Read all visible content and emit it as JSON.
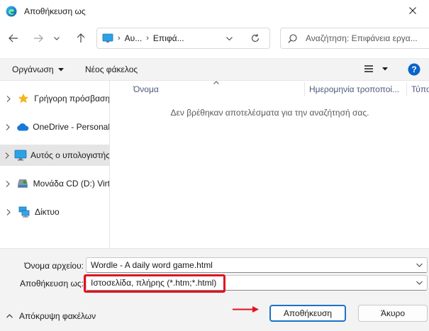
{
  "window": {
    "title": "Αποθήκευση ως"
  },
  "address": {
    "crumbs": [
      "Αυ...",
      "Επιφά..."
    ]
  },
  "search": {
    "placeholder": "Αναζήτηση: Επιφάνεια εργα..."
  },
  "toolbar": {
    "organize_label": "Οργάνωση",
    "new_folder_label": "Νέος φάκελος"
  },
  "sidebar": {
    "items": [
      {
        "label": "Γρήγορη πρόσβαση",
        "icon": "star-icon"
      },
      {
        "label": "OneDrive - Personal",
        "icon": "cloud-icon"
      },
      {
        "label": "Αυτός ο υπολογιστής",
        "icon": "computer-icon",
        "selected": true
      },
      {
        "label": "Μονάδα CD (D:) Virt",
        "icon": "cd-drive-icon"
      },
      {
        "label": "Δίκτυο",
        "icon": "network-icon"
      }
    ]
  },
  "filelist": {
    "columns": [
      "Όνομα",
      "Ημερομηνία τροποποί...",
      "Τύπος"
    ],
    "empty_message": "Δεν βρέθηκαν αποτελέσματα για την αναζήτησή σας."
  },
  "form": {
    "filename_label": "Όνομα αρχείου:",
    "filename_value": "Wordle - A daily word game.html",
    "savetype_label": "Αποθήκευση ως:",
    "savetype_value": "Ιστοσελίδα, πλήρης (*.htm;*.html)"
  },
  "footer": {
    "hide_folders_label": "Απόκρυψη φακέλων",
    "save_label": "Αποθήκευση",
    "cancel_label": "Άκυρο"
  },
  "colors": {
    "accent": "#1a73c8",
    "highlight": "#e0121f",
    "help": "#0a63c9"
  }
}
